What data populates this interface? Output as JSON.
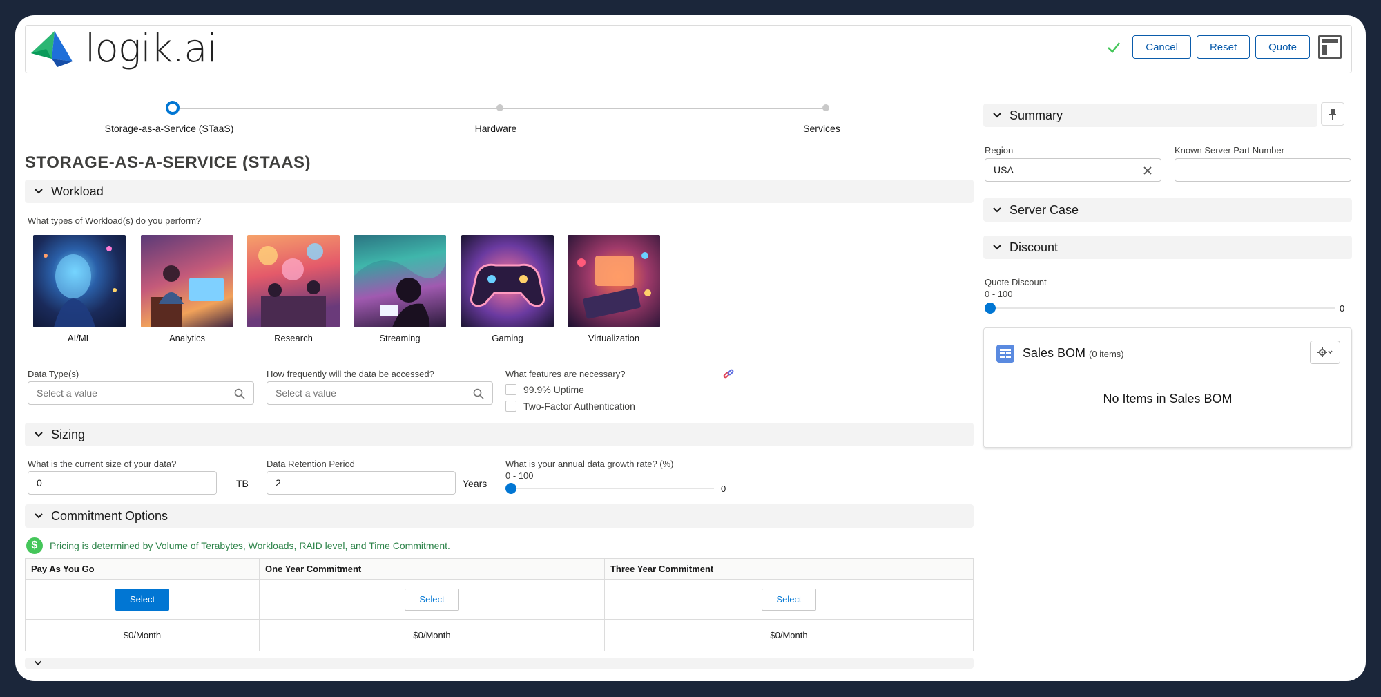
{
  "app": {
    "logo_text": "logik.ai"
  },
  "header": {
    "actions": {
      "cancel": "Cancel",
      "reset": "Reset",
      "quote": "Quote"
    }
  },
  "steps": [
    {
      "label": "Storage-as-a-Service (STaaS)",
      "state": "current"
    },
    {
      "label": "Hardware",
      "state": "upcoming"
    },
    {
      "label": "Services",
      "state": "upcoming"
    }
  ],
  "page_title": "STORAGE-AS-A-SERVICE (STAAS)",
  "workload": {
    "section_label": "Workload",
    "question": "What types of Workload(s) do you perform?",
    "tiles": [
      {
        "label": "AI/ML"
      },
      {
        "label": "Analytics"
      },
      {
        "label": "Research"
      },
      {
        "label": "Streaming"
      },
      {
        "label": "Gaming"
      },
      {
        "label": "Virtualization"
      }
    ],
    "data_types": {
      "label": "Data Type(s)",
      "placeholder": "Select a value"
    },
    "frequency": {
      "label": "How frequently will the data be accessed?",
      "placeholder": "Select a value"
    },
    "features": {
      "label": "What features are necessary?",
      "options": [
        {
          "label": "99.9% Uptime"
        },
        {
          "label": "Two-Factor Authentication"
        }
      ]
    }
  },
  "sizing": {
    "section_label": "Sizing",
    "current_size": {
      "label": "What is the current size of your data?",
      "value": "0",
      "unit": "TB"
    },
    "retention": {
      "label": "Data Retention Period",
      "value": "2",
      "unit": "Years"
    },
    "growth": {
      "label": "What is your annual data growth rate? (%)",
      "range": "0 - 100",
      "value": "0",
      "fraction": 0
    }
  },
  "commitment": {
    "section_label": "Commitment Options",
    "info": "Pricing is determined by Volume of Terabytes, Workloads, RAID level, and Time Commitment.",
    "columns": [
      {
        "header": "Pay As You Go",
        "button": "Select",
        "price": "$0/Month",
        "selected": true
      },
      {
        "header": "One Year Commitment",
        "button": "Select",
        "price": "$0/Month",
        "selected": false
      },
      {
        "header": "Three Year Commitment",
        "button": "Select",
        "price": "$0/Month",
        "selected": false
      }
    ]
  },
  "summary": {
    "section_label": "Summary",
    "region": {
      "label": "Region",
      "value": "USA"
    },
    "part_number": {
      "label": "Known Server Part Number",
      "value": ""
    },
    "server_case": {
      "section_label": "Server Case"
    },
    "discount": {
      "section_label": "Discount",
      "label": "Quote Discount",
      "range": "0 - 100",
      "value": "0",
      "fraction": 0
    }
  },
  "sales_bom": {
    "title": "Sales BOM",
    "count": "(0 items)",
    "empty_text": "No Items in Sales BOM"
  },
  "colors": {
    "brand_blue": "#0176d3",
    "success_green": "#45c65a",
    "info_green": "#2e844a"
  }
}
